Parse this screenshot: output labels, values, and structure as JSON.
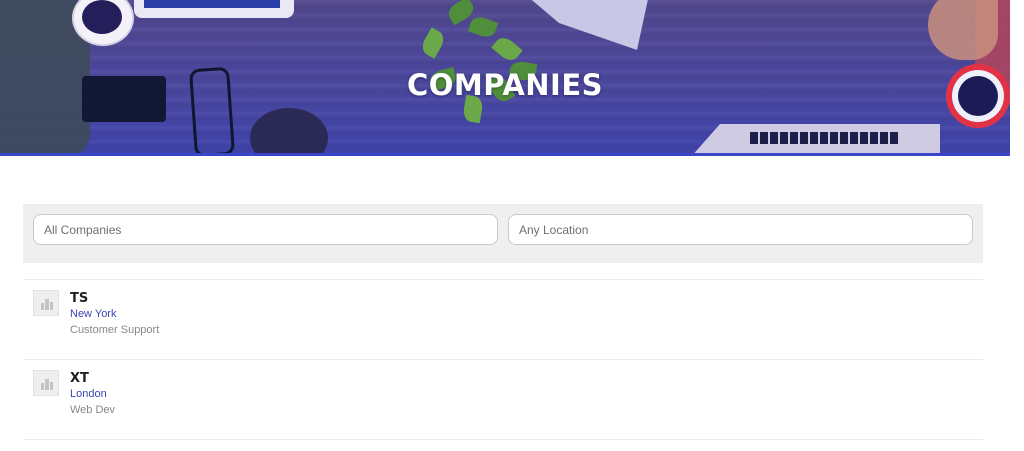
{
  "hero": {
    "title": "COMPANIES",
    "accent_color": "#3a45c8"
  },
  "search": {
    "company_placeholder": "All Companies",
    "location_placeholder": "Any Location"
  },
  "companies": [
    {
      "name": "TS",
      "location": "New York",
      "category": "Customer Support",
      "logo_icon": "building-icon"
    },
    {
      "name": "XT",
      "location": "London",
      "category": "Web Dev",
      "logo_icon": "building-icon"
    }
  ],
  "colors": {
    "link": "#3b46b4",
    "muted": "#888888",
    "panel": "#efefef"
  }
}
